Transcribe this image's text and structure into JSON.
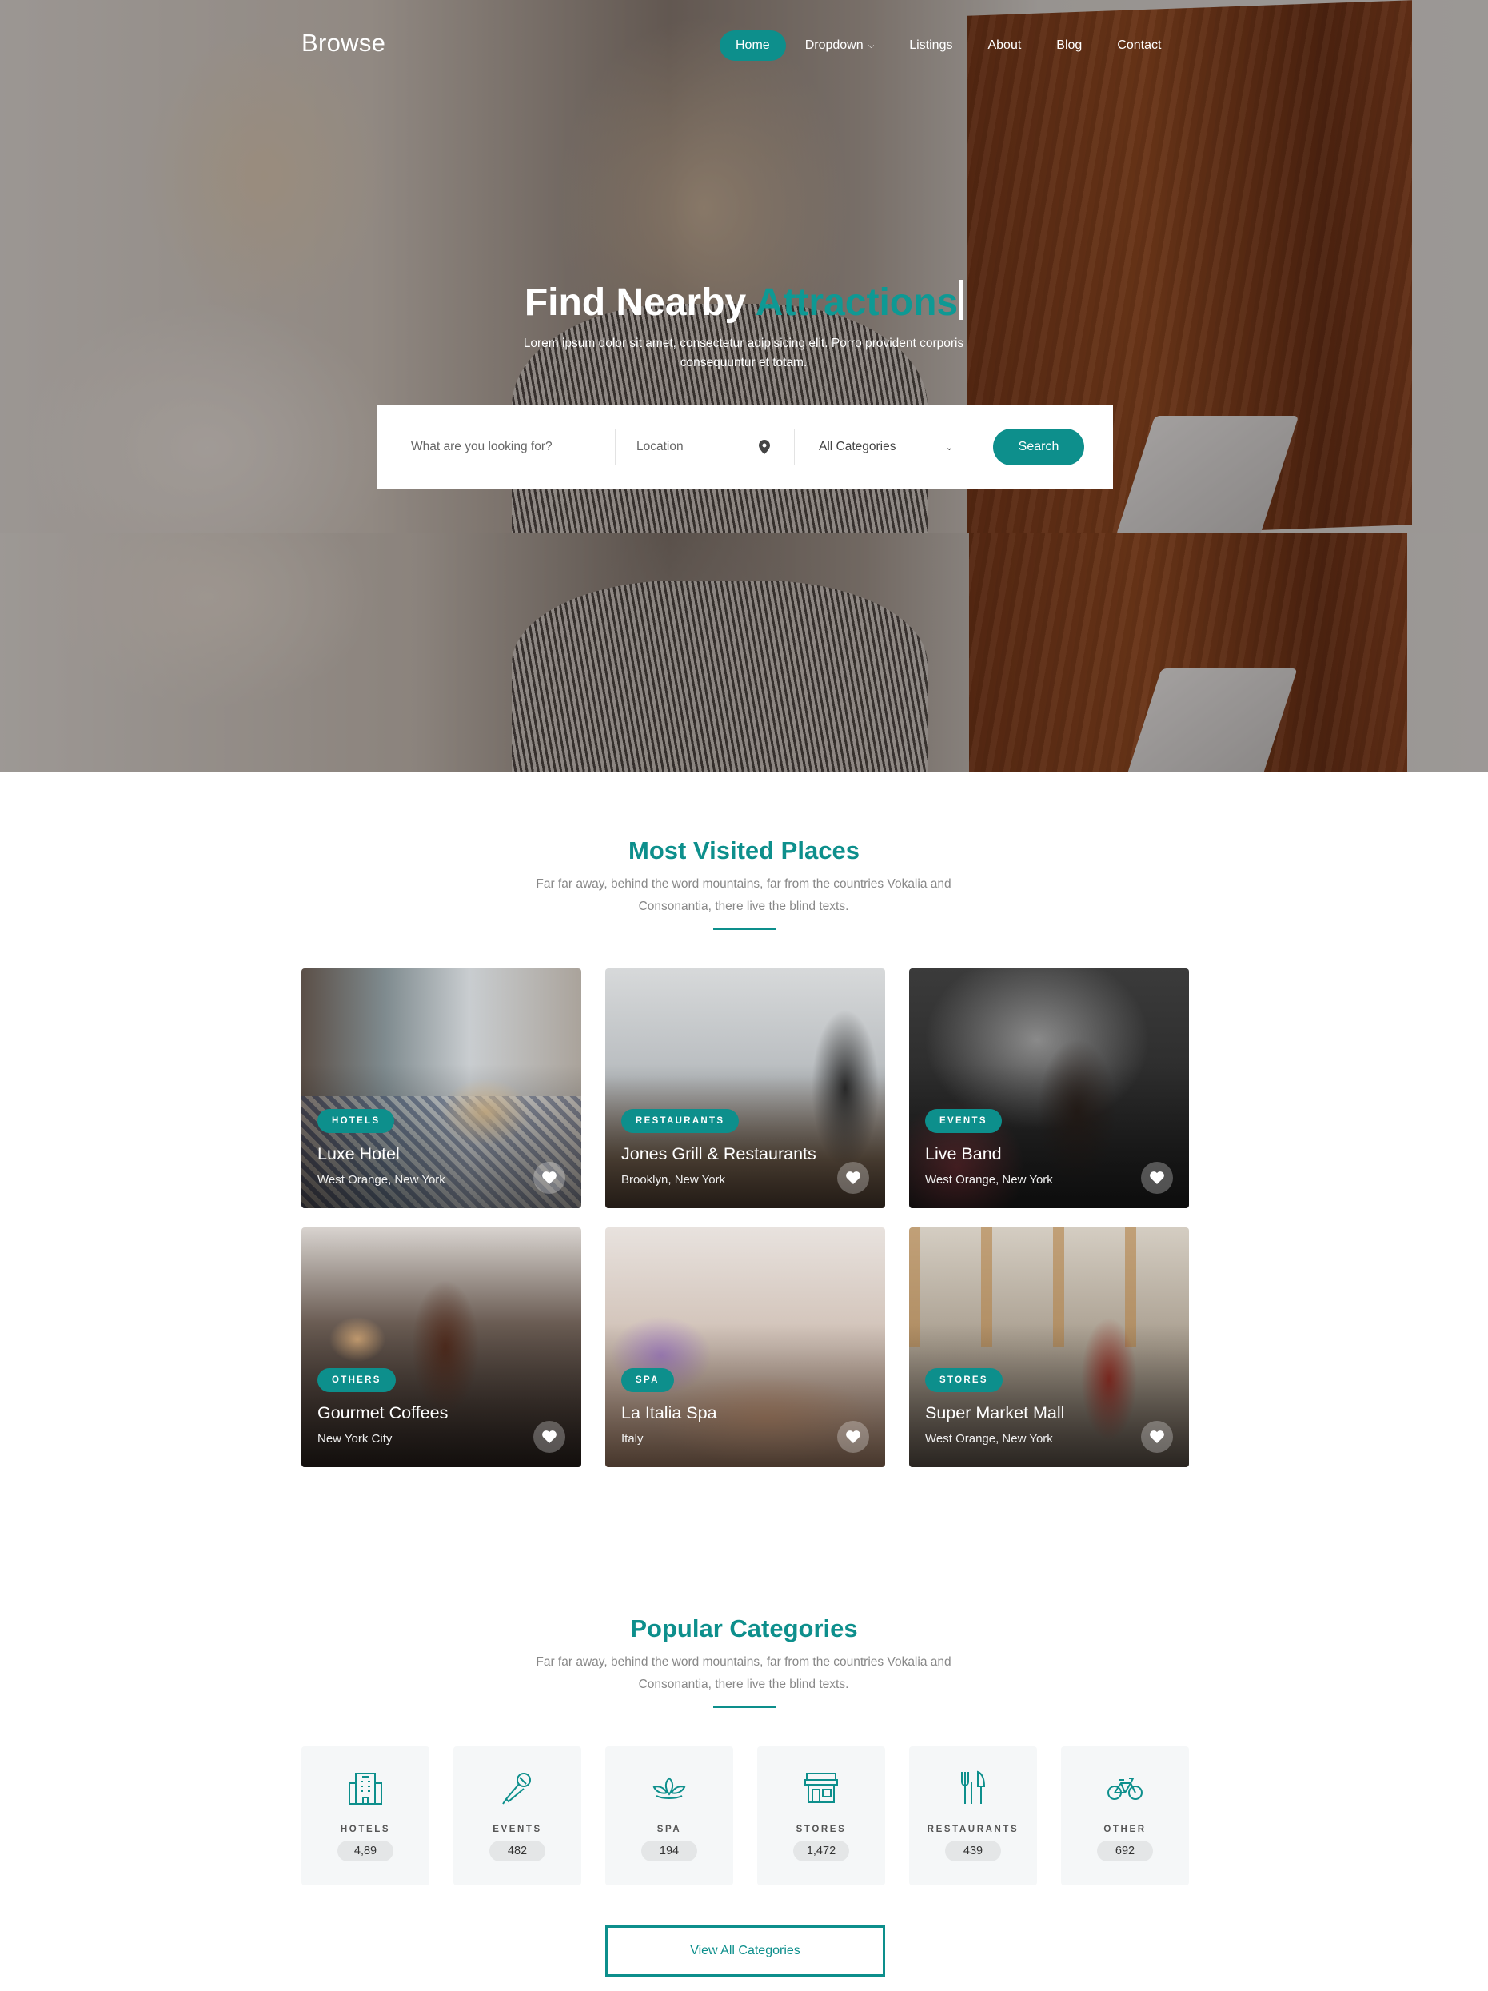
{
  "header": {
    "brand": "Browse",
    "nav": [
      {
        "label": "Home",
        "active": true
      },
      {
        "label": "Dropdown",
        "has_caret": true
      },
      {
        "label": "Listings"
      },
      {
        "label": "About"
      },
      {
        "label": "Blog"
      },
      {
        "label": "Contact"
      }
    ]
  },
  "hero": {
    "title_plain": "Find Nearby ",
    "title_accent": "Attractions",
    "subtitle": "Lorem ipsum dolor sit amet, consectetur adipisicing elit. Porro provident corporis consequuntur et totam.",
    "search": {
      "what_placeholder": "What are you looking for?",
      "location_placeholder": "Location",
      "category_selected": "All Categories",
      "button_label": "Search"
    }
  },
  "most_visited": {
    "title": "Most Visited Places",
    "subtitle": "Far far away, behind the word mountains, far from the countries Vokalia and Consonantia, there live the blind texts.",
    "places": [
      {
        "badge": "HOTELS",
        "name": "Luxe Hotel",
        "location": "West Orange, New York"
      },
      {
        "badge": "RESTAURANTS",
        "name": "Jones Grill & Restaurants",
        "location": "Brooklyn, New York"
      },
      {
        "badge": "EVENTS",
        "name": "Live Band",
        "location": "West Orange, New York"
      },
      {
        "badge": "OTHERS",
        "name": "Gourmet Coffees",
        "location": "New York City"
      },
      {
        "badge": "SPA",
        "name": "La Italia Spa",
        "location": "Italy"
      },
      {
        "badge": "STORES",
        "name": "Super Market Mall",
        "location": "West Orange, New York"
      }
    ]
  },
  "popular_categories": {
    "title": "Popular Categories",
    "subtitle": "Far far away, behind the word mountains, far from the countries Vokalia and Consonantia, there live the blind texts.",
    "categories": [
      {
        "label": "HOTELS",
        "count": "4,89",
        "icon": "hotel-icon"
      },
      {
        "label": "EVENTS",
        "count": "482",
        "icon": "microphone-icon"
      },
      {
        "label": "SPA",
        "count": "194",
        "icon": "lotus-icon"
      },
      {
        "label": "STORES",
        "count": "1,472",
        "icon": "store-icon"
      },
      {
        "label": "RESTAURANTS",
        "count": "439",
        "icon": "fork-knife-icon"
      },
      {
        "label": "OTHER",
        "count": "692",
        "icon": "bicycle-icon"
      }
    ],
    "view_all_label": "View All Categories"
  },
  "colors": {
    "accent": "#0d8f8c",
    "text_muted": "#888888",
    "tile_bg": "#f5f7f8"
  }
}
